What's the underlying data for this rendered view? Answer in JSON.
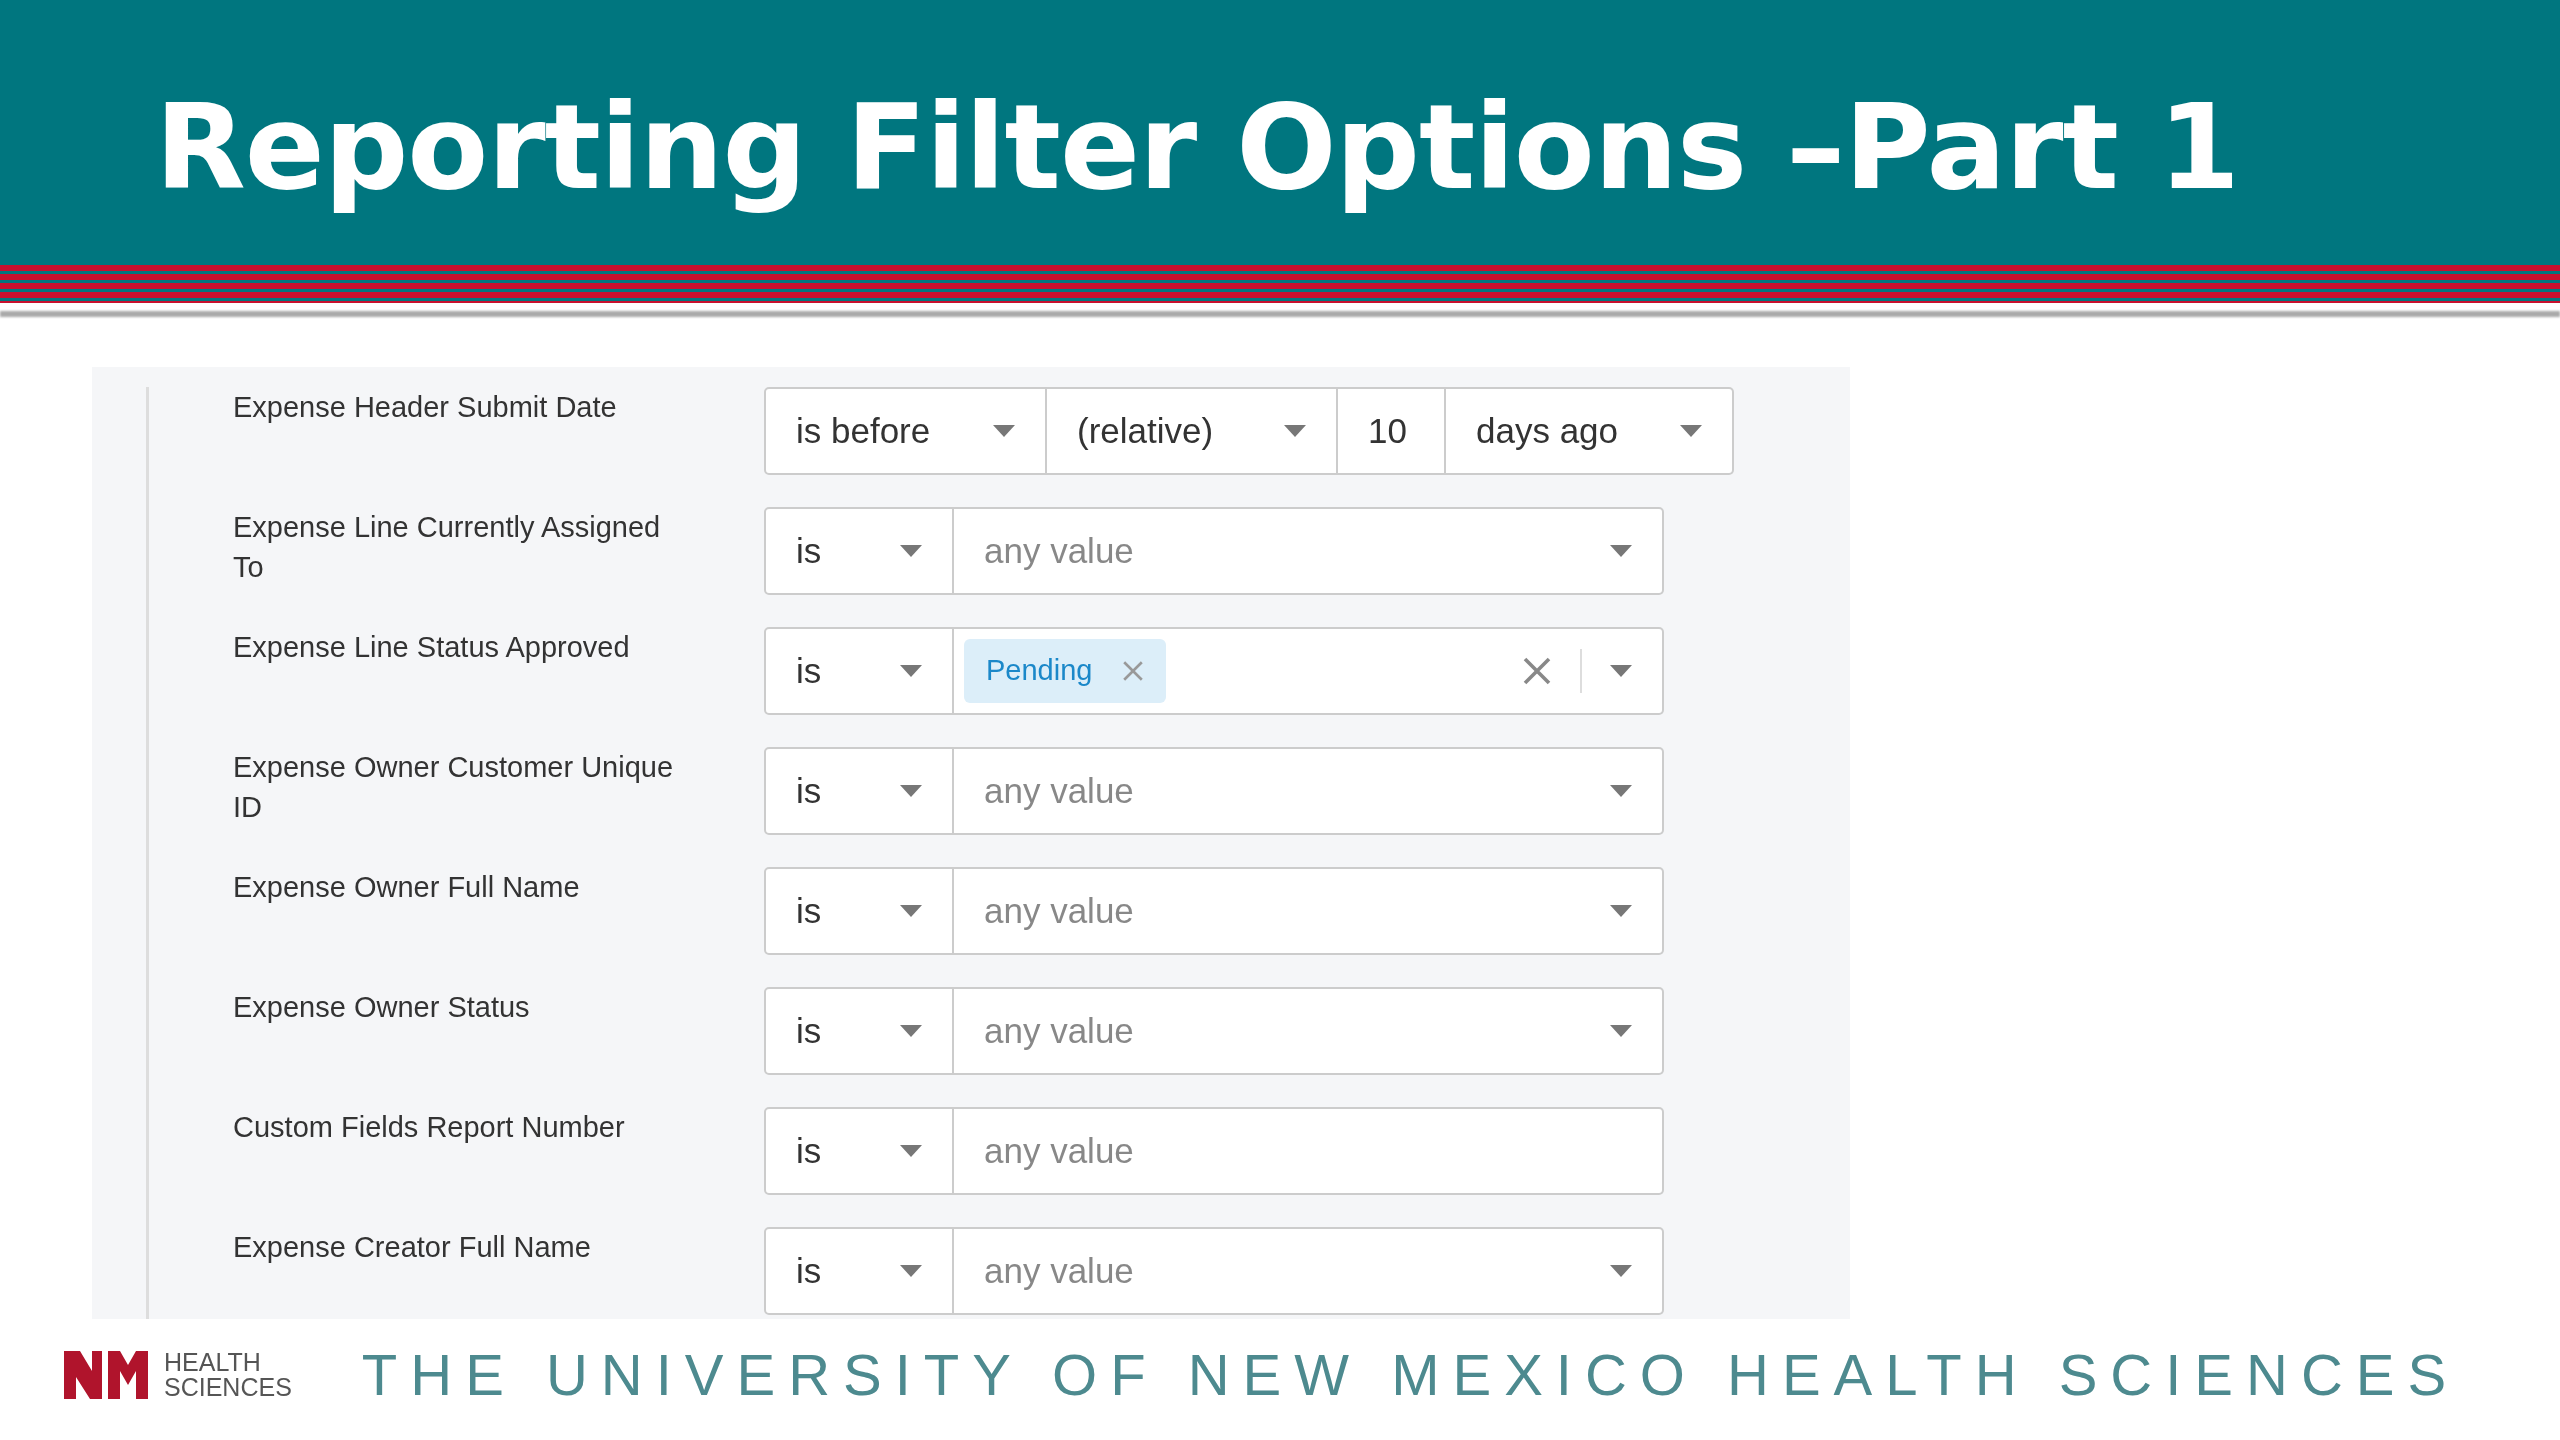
{
  "slide_title": "Reporting Filter Options –Part 1",
  "filters": [
    {
      "label": "Expense Header Submit Date",
      "kind": "date_relative",
      "operator": "is before",
      "mode": "(relative)",
      "amount": "10",
      "unit": "days ago"
    },
    {
      "label": "Expense Line Currently Assigned To",
      "kind": "select",
      "operator": "is",
      "placeholder": "any value"
    },
    {
      "label": "Expense Line Status Approved",
      "kind": "tags",
      "operator": "is",
      "tags": [
        "Pending"
      ]
    },
    {
      "label": "Expense Owner Customer Unique ID",
      "kind": "select",
      "operator": "is",
      "placeholder": "any value"
    },
    {
      "label": "Expense Owner Full Name",
      "kind": "select",
      "operator": "is",
      "placeholder": "any value"
    },
    {
      "label": "Expense Owner Status",
      "kind": "select",
      "operator": "is",
      "placeholder": "any value"
    },
    {
      "label": "Custom Fields Report Number",
      "kind": "text",
      "operator": "is",
      "placeholder": "any value"
    },
    {
      "label": "Expense Creator Full Name",
      "kind": "select",
      "operator": "is",
      "placeholder": "any value"
    }
  ],
  "footer": {
    "logo_lines": [
      "HEALTH",
      "SCIENCES"
    ],
    "tagline": "THE UNIVERSITY OF NEW MEXICO HEALTH SCIENCES"
  }
}
